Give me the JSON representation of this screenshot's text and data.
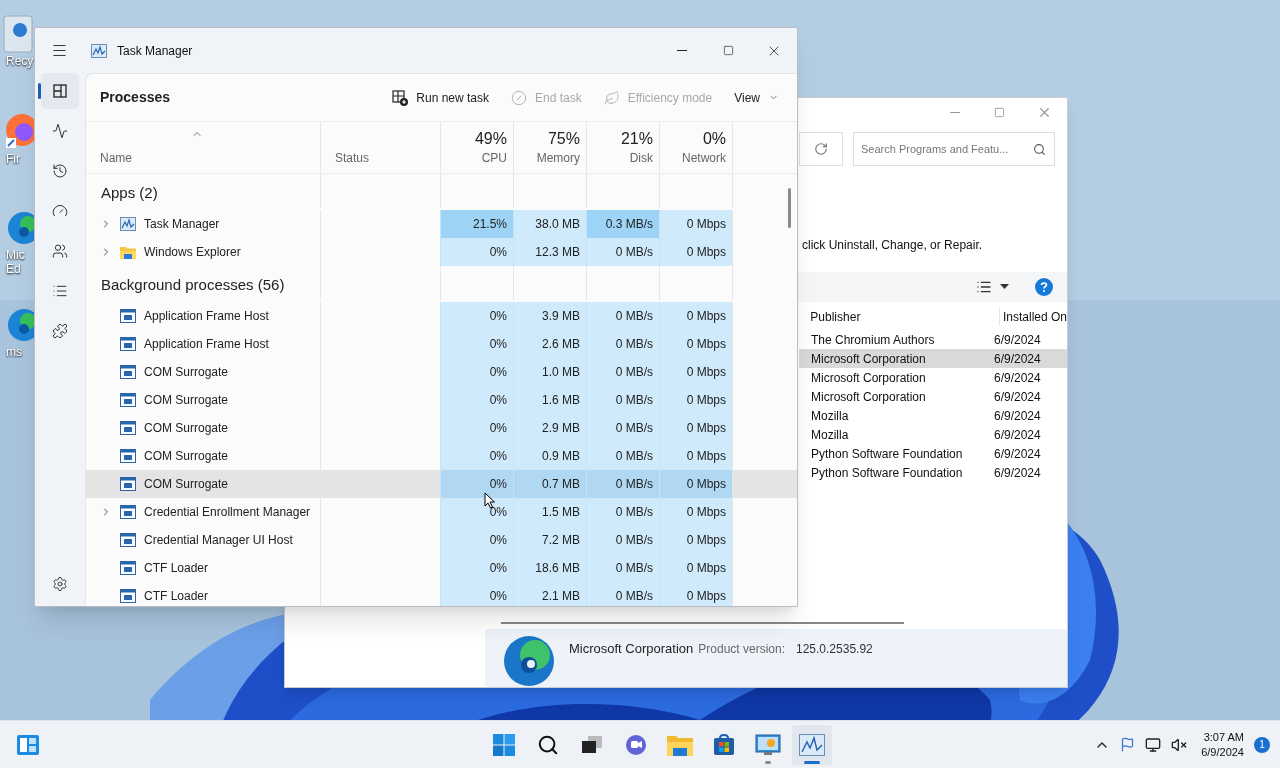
{
  "desktop": {
    "icons": [
      {
        "kind": "recycle",
        "label_lines": [
          "Recy"
        ]
      },
      {
        "kind": "firefox",
        "label_lines": [
          "Fir"
        ]
      },
      {
        "kind": "edge",
        "label_lines": [
          "Mic",
          "Ed"
        ]
      },
      {
        "kind": "edge",
        "label_lines": [
          "ms"
        ]
      }
    ]
  },
  "programs_window": {
    "search": {
      "placeholder": "Search Programs and Featu..."
    },
    "instruction": "click Uninstall, Change, or Repair.",
    "columns": [
      "Publisher",
      "Installed On"
    ],
    "rows": [
      {
        "publisher": "The Chromium Authors",
        "installed_on": "6/9/2024",
        "selected": false
      },
      {
        "publisher": "Microsoft Corporation",
        "installed_on": "6/9/2024",
        "selected": true
      },
      {
        "publisher": "Microsoft Corporation",
        "installed_on": "6/9/2024",
        "selected": false
      },
      {
        "publisher": "Microsoft Corporation",
        "installed_on": "6/9/2024",
        "selected": false
      },
      {
        "publisher": "Mozilla",
        "installed_on": "6/9/2024",
        "selected": false
      },
      {
        "publisher": "Mozilla",
        "installed_on": "6/9/2024",
        "selected": false
      },
      {
        "publisher": "Python Software Foundation",
        "installed_on": "6/9/2024",
        "selected": false
      },
      {
        "publisher": "Python Software Foundation",
        "installed_on": "6/9/2024",
        "selected": false
      }
    ],
    "details": {
      "publisher": "Microsoft Corporation",
      "version_label": "Product version:",
      "version": "125.0.2535.92"
    }
  },
  "task_manager": {
    "title": "Task Manager",
    "nav": [
      {
        "kind": "processes",
        "selected": true
      },
      {
        "kind": "performance",
        "selected": false
      },
      {
        "kind": "history",
        "selected": false
      },
      {
        "kind": "startup",
        "selected": false
      },
      {
        "kind": "users",
        "selected": false
      },
      {
        "kind": "details",
        "selected": false
      },
      {
        "kind": "services",
        "selected": false
      }
    ],
    "page_title": "Processes",
    "toolbar": [
      {
        "kind": "run",
        "label": "Run new task",
        "disabled": false
      },
      {
        "kind": "end",
        "label": "End task",
        "disabled": true
      },
      {
        "kind": "efficiency",
        "label": "Efficiency mode",
        "disabled": true
      },
      {
        "kind": "view",
        "label": "View",
        "disabled": false
      }
    ],
    "columns": [
      {
        "label": "Name"
      },
      {
        "label": "Status"
      },
      {
        "percent": "49%",
        "label": "CPU"
      },
      {
        "percent": "75%",
        "label": "Memory"
      },
      {
        "percent": "21%",
        "label": "Disk"
      },
      {
        "percent": "0%",
        "label": "Network"
      }
    ],
    "groups": [
      {
        "title": "Apps (2)",
        "rows": [
          {
            "name": "Task Manager",
            "kind": "taskmgr",
            "expandable": true,
            "hovered": false,
            "cells": [
              {
                "value": "21.5%",
                "hot": true
              },
              {
                "value": "38.0 MB",
                "hot": false
              },
              {
                "value": "0.3 MB/s",
                "hot": true
              },
              {
                "value": "0 Mbps",
                "hot": false
              }
            ]
          },
          {
            "name": "Windows Explorer",
            "kind": "folder",
            "expandable": true,
            "hovered": false,
            "cells": [
              {
                "value": "0%",
                "hot": false
              },
              {
                "value": "12.3 MB",
                "hot": false
              },
              {
                "value": "0 MB/s",
                "hot": false
              },
              {
                "value": "0 Mbps",
                "hot": false
              }
            ]
          }
        ]
      },
      {
        "title": "Background processes (56)",
        "rows": [
          {
            "name": "Application Frame Host",
            "kind": "app",
            "expandable": false,
            "hovered": false,
            "cells": [
              {
                "value": "0%",
                "hot": false
              },
              {
                "value": "3.9 MB",
                "hot": false
              },
              {
                "value": "0 MB/s",
                "hot": false
              },
              {
                "value": "0 Mbps",
                "hot": false
              }
            ]
          },
          {
            "name": "Application Frame Host",
            "kind": "app",
            "expandable": false,
            "hovered": false,
            "cells": [
              {
                "value": "0%",
                "hot": false
              },
              {
                "value": "2.6 MB",
                "hot": false
              },
              {
                "value": "0 MB/s",
                "hot": false
              },
              {
                "value": "0 Mbps",
                "hot": false
              }
            ]
          },
          {
            "name": "COM Surrogate",
            "kind": "app",
            "expandable": false,
            "hovered": false,
            "cells": [
              {
                "value": "0%",
                "hot": false
              },
              {
                "value": "1.0 MB",
                "hot": false
              },
              {
                "value": "0 MB/s",
                "hot": false
              },
              {
                "value": "0 Mbps",
                "hot": false
              }
            ]
          },
          {
            "name": "COM Surrogate",
            "kind": "app",
            "expandable": false,
            "hovered": false,
            "cells": [
              {
                "value": "0%",
                "hot": false
              },
              {
                "value": "1.6 MB",
                "hot": false
              },
              {
                "value": "0 MB/s",
                "hot": false
              },
              {
                "value": "0 Mbps",
                "hot": false
              }
            ]
          },
          {
            "name": "COM Surrogate",
            "kind": "app",
            "expandable": false,
            "hovered": false,
            "cells": [
              {
                "value": "0%",
                "hot": false
              },
              {
                "value": "2.9 MB",
                "hot": false
              },
              {
                "value": "0 MB/s",
                "hot": false
              },
              {
                "value": "0 Mbps",
                "hot": false
              }
            ]
          },
          {
            "name": "COM Surrogate",
            "kind": "app",
            "expandable": false,
            "hovered": false,
            "cells": [
              {
                "value": "0%",
                "hot": false
              },
              {
                "value": "0.9 MB",
                "hot": false
              },
              {
                "value": "0 MB/s",
                "hot": false
              },
              {
                "value": "0 Mbps",
                "hot": false
              }
            ]
          },
          {
            "name": "COM Surrogate",
            "kind": "app",
            "expandable": false,
            "hovered": true,
            "cells": [
              {
                "value": "0%",
                "hot": false
              },
              {
                "value": "0.7 MB",
                "hot": false
              },
              {
                "value": "0 MB/s",
                "hot": false
              },
              {
                "value": "0 Mbps",
                "hot": false
              }
            ]
          },
          {
            "name": "Credential Enrollment Manager",
            "kind": "app",
            "expandable": true,
            "hovered": false,
            "cells": [
              {
                "value": "0%",
                "hot": false
              },
              {
                "value": "1.5 MB",
                "hot": false
              },
              {
                "value": "0 MB/s",
                "hot": false
              },
              {
                "value": "0 Mbps",
                "hot": false
              }
            ]
          },
          {
            "name": "Credential Manager UI Host",
            "kind": "app",
            "expandable": false,
            "hovered": false,
            "cells": [
              {
                "value": "0%",
                "hot": false
              },
              {
                "value": "7.2 MB",
                "hot": false
              },
              {
                "value": "0 MB/s",
                "hot": false
              },
              {
                "value": "0 Mbps",
                "hot": false
              }
            ]
          },
          {
            "name": "CTF Loader",
            "kind": "app",
            "expandable": false,
            "hovered": false,
            "cells": [
              {
                "value": "0%",
                "hot": false
              },
              {
                "value": "18.6 MB",
                "hot": false
              },
              {
                "value": "0 MB/s",
                "hot": false
              },
              {
                "value": "0 Mbps",
                "hot": false
              }
            ]
          },
          {
            "name": "CTF Loader",
            "kind": "app",
            "expandable": false,
            "hovered": false,
            "cells": [
              {
                "value": "0%",
                "hot": false
              },
              {
                "value": "2.1 MB",
                "hot": false
              },
              {
                "value": "0 MB/s",
                "hot": false
              },
              {
                "value": "0 Mbps",
                "hot": false
              }
            ]
          }
        ]
      }
    ]
  },
  "taskbar": {
    "apps": [
      {
        "kind": "start",
        "running": false,
        "active": false
      },
      {
        "kind": "search",
        "running": false,
        "active": false
      },
      {
        "kind": "taskview",
        "running": false,
        "active": false
      },
      {
        "kind": "chat",
        "running": false,
        "active": false
      },
      {
        "kind": "explorer",
        "running": false,
        "active": false
      },
      {
        "kind": "store",
        "running": false,
        "active": false
      },
      {
        "kind": "control",
        "running": true,
        "active": false
      },
      {
        "kind": "taskmgr",
        "running": true,
        "active": true
      }
    ],
    "clock": {
      "time": "3:07 AM",
      "date": "6/9/2024"
    },
    "notifications": "1"
  }
}
